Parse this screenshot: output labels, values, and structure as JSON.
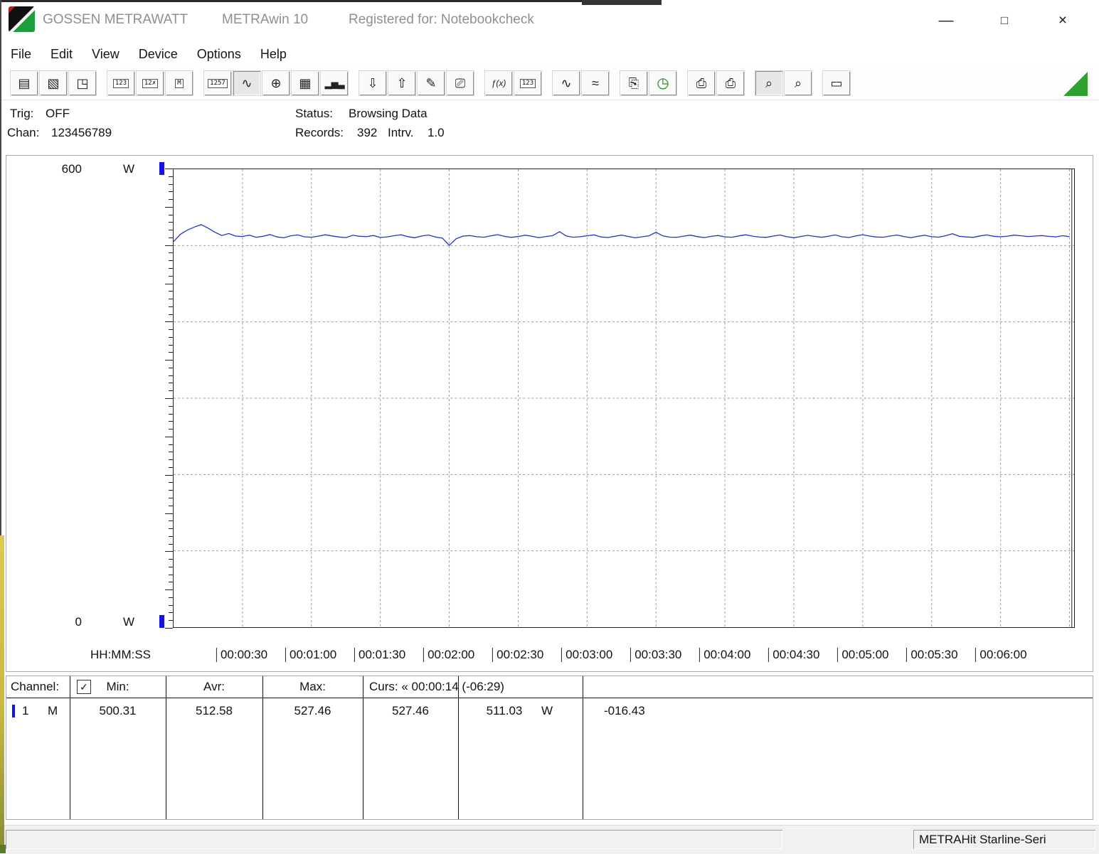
{
  "window": {
    "brand": "GOSSEN METRAWATT",
    "app": "METRAwin 10",
    "registered": "Registered for: Notebookcheck",
    "controls": {
      "minimize": "—",
      "maximize": "□",
      "close": "×"
    }
  },
  "menu": {
    "items": [
      "File",
      "Edit",
      "View",
      "Device",
      "Options",
      "Help"
    ]
  },
  "toolbar": {
    "groups": [
      [
        {
          "name": "save",
          "label": "Save",
          "glyph": "▤"
        },
        {
          "name": "save-as",
          "label": "Save As",
          "glyph": "▧"
        },
        {
          "name": "open-file",
          "label": "Open",
          "glyph": "◳"
        }
      ],
      [
        {
          "name": "device-read",
          "label": "Read device",
          "glyph": "123",
          "cls": "boxed"
        },
        {
          "name": "device-stop",
          "label": "Stop device",
          "glyph": "12✗",
          "cls": "boxed"
        },
        {
          "name": "device-memory",
          "label": "Device memory",
          "glyph": "M",
          "cls": "boxed"
        }
      ],
      [
        {
          "name": "digital-display",
          "label": "Digital display",
          "glyph": "1257",
          "cls": "boxed"
        },
        {
          "name": "trend-graph",
          "label": "Trend graph Y-t",
          "glyph": "∿",
          "pressed": true
        },
        {
          "name": "analog-display",
          "label": "Analog display",
          "glyph": "⊕"
        },
        {
          "name": "table-view",
          "label": "Data table",
          "glyph": "▦"
        },
        {
          "name": "bar-graph",
          "label": "Bar graph",
          "glyph": "▂▅▃",
          "cls": "bars"
        }
      ],
      [
        {
          "name": "export-data",
          "label": "Export data",
          "glyph": "⇩"
        },
        {
          "name": "import-data",
          "label": "Import data",
          "glyph": "⇧"
        },
        {
          "name": "protocol-edit",
          "label": "Edit protocol",
          "glyph": "✎"
        },
        {
          "name": "monitor-view",
          "label": "Monitor",
          "glyph": "⎚"
        }
      ],
      [
        {
          "name": "formula",
          "label": "Formula",
          "glyph": "ƒ(x)",
          "cls": "small"
        },
        {
          "name": "numeric-window",
          "label": "Numeric window",
          "glyph": "123",
          "cls": "boxed"
        }
      ],
      [
        {
          "name": "signal-smooth",
          "label": "Curve",
          "glyph": "∿"
        },
        {
          "name": "signal-raw",
          "label": "Envelope",
          "glyph": "≈"
        }
      ],
      [
        {
          "name": "page-copy",
          "label": "Copy page",
          "glyph": "⎘"
        },
        {
          "name": "timer",
          "label": "Timer",
          "glyph": "◷",
          "cls": "green"
        }
      ],
      [
        {
          "name": "print-preview",
          "label": "Print preview",
          "glyph": "⎙"
        },
        {
          "name": "print",
          "label": "Print",
          "glyph": "⎙"
        }
      ],
      [
        {
          "name": "zoom-signal",
          "label": "Zoom curve",
          "glyph": "⌕",
          "pressed": true
        },
        {
          "name": "zoom",
          "label": "Zoom",
          "glyph": "⌕"
        }
      ],
      [
        {
          "name": "label-note",
          "label": "Label",
          "glyph": "▭"
        }
      ]
    ]
  },
  "info": {
    "trig_label": "Trig:",
    "trig_value": "OFF",
    "chan_label": "Chan:",
    "chan_value": "123456789",
    "status_label": "Status:",
    "status_value": "Browsing Data",
    "records_label": "Records:",
    "records_value": "392",
    "interval_label": "Intrv.",
    "interval_value": "1.0"
  },
  "chart_data": {
    "type": "line",
    "title": "",
    "xlabel": "HH:MM:SS",
    "ylabel": "W",
    "ylim": [
      0,
      600
    ],
    "xlim_seconds": [
      0,
      392
    ],
    "interval_seconds": 3,
    "grid": {
      "x_step_seconds": 30,
      "y_step": 100,
      "style": "dashed"
    },
    "legend_position": "none",
    "y_axis": {
      "top_label": "600",
      "bottom_label": "0",
      "unit": "W"
    },
    "x_unit_label": "HH:MM:SS",
    "x_tick_seconds": [
      30,
      60,
      90,
      120,
      150,
      180,
      210,
      240,
      270,
      300,
      330,
      360
    ],
    "x_tick_labels": [
      "00:00:30",
      "00:01:00",
      "00:01:30",
      "00:02:00",
      "00:02:30",
      "00:03:00",
      "00:03:30",
      "00:04:00",
      "00:04:30",
      "00:05:00",
      "00:05:30",
      "00:06:00"
    ],
    "cursor_seconds": 391,
    "series": [
      {
        "name": "Channel 1",
        "unit": "W",
        "color": "#2233cc",
        "min": 500.31,
        "avg": 512.58,
        "max": 527.46,
        "values": [
          505.2,
          514.8,
          520.3,
          524.1,
          527.46,
          522.8,
          517.5,
          513.2,
          515.8,
          512.4,
          511.9,
          513.6,
          510.8,
          512.2,
          514.5,
          511.3,
          510.2,
          512.8,
          513.9,
          511.5,
          510.9,
          512.3,
          514.1,
          512.6,
          511.2,
          510.5,
          513.4,
          512.1,
          511.8,
          513.2,
          510.6,
          511.4,
          512.9,
          514.2,
          511.7,
          510.3,
          512.5,
          513.8,
          511.1,
          509.8,
          500.31,
          508.9,
          512.4,
          513.1,
          511.6,
          510.9,
          512.7,
          514.3,
          512.0,
          510.7,
          511.9,
          513.5,
          512.2,
          510.4,
          511.8,
          513.0,
          518.2,
          512.5,
          510.9,
          511.6,
          512.8,
          514.0,
          511.3,
          510.6,
          512.1,
          513.7,
          511.9,
          510.2,
          511.5,
          512.9,
          517.4,
          512.6,
          511.0,
          510.8,
          512.3,
          513.6,
          511.7,
          510.5,
          512.0,
          513.2,
          511.4,
          510.9,
          512.6,
          514.1,
          512.3,
          511.1,
          510.7,
          512.4,
          513.8,
          511.6,
          510.3,
          511.9,
          513.3,
          512.0,
          510.8,
          512.2,
          513.9,
          511.5,
          510.6,
          512.7,
          514.2,
          512.4,
          511.2,
          510.9,
          512.5,
          513.7,
          511.8,
          510.4,
          512.1,
          513.4,
          511.6,
          511.0,
          512.8,
          515.5,
          512.2,
          511.3,
          510.7,
          512.6,
          513.9,
          512.1,
          511.5,
          512.3,
          513.6,
          512.8,
          511.9,
          512.4,
          513.1,
          512.0,
          511.4,
          512.9,
          511.7
        ]
      }
    ]
  },
  "table": {
    "header": {
      "channel": "Channel:",
      "check": "✓",
      "min": "Min:",
      "avr": "Avr:",
      "max": "Max:",
      "cursor": "Curs: « 00:00:14 (-06:29)"
    },
    "row": {
      "channel": "1",
      "mode": "M",
      "min": "500.31",
      "avr": "512.58",
      "max": "527.46",
      "cursor_a": "527.46",
      "cursor_b": "511.03",
      "unit": "W",
      "delta": "-016.43"
    }
  },
  "statusbar": {
    "device_label": "METRAHit Starline-Seri"
  }
}
